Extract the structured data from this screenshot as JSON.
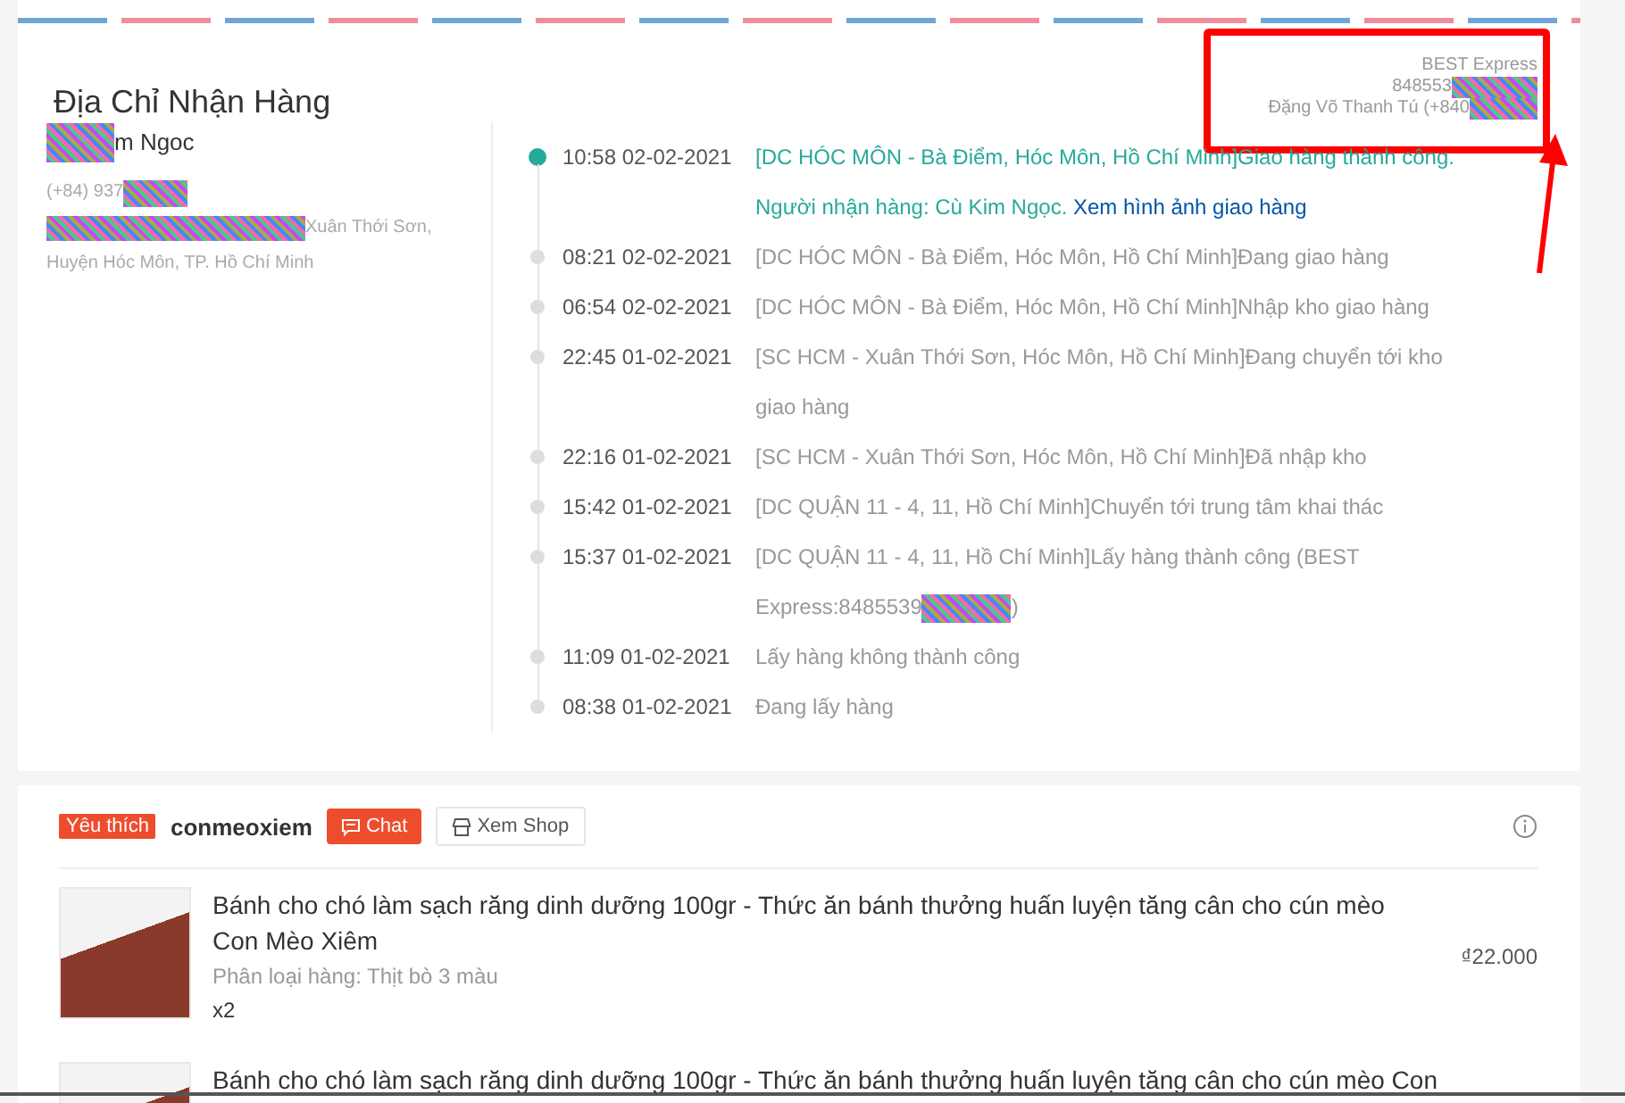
{
  "address": {
    "title": "Địa Chỉ Nhận Hàng",
    "name_tail": "m Ngoc",
    "phone": "(+84) 937",
    "address_line": "Xuân Thới Sơn,",
    "address_line_2": "Huyện Hóc Môn, TP. Hồ Chí Minh"
  },
  "carrier": {
    "name": "BEST Express",
    "tracking": "848553",
    "shipper": "Đặng Võ Thanh Tú (+840"
  },
  "events": [
    {
      "time": "10:58 02-02-2021",
      "active": true,
      "segments": [
        {
          "kind": "text",
          "text": "[DC HÓC MÔN - Bà Điểm, Hóc Môn, Hồ Chí Minh]Giao hàng thành công. Người nhận hàng: Cù Kim Ngọc. "
        },
        {
          "kind": "link",
          "text": "Xem hình ảnh giao hàng"
        }
      ]
    },
    {
      "time": "08:21 02-02-2021",
      "active": false,
      "segments": [
        {
          "kind": "text",
          "text": "[DC HÓC MÔN - Bà Điểm, Hóc Môn, Hồ Chí Minh]Đang giao hàng"
        }
      ]
    },
    {
      "time": "06:54 02-02-2021",
      "active": false,
      "segments": [
        {
          "kind": "text",
          "text": "[DC HÓC MÔN - Bà Điểm, Hóc Môn, Hồ Chí Minh]Nhập kho giao hàng"
        }
      ]
    },
    {
      "time": "22:45 01-02-2021",
      "active": false,
      "segments": [
        {
          "kind": "text",
          "text": "[SC HCM - Xuân Thới Sơn, Hóc Môn, Hồ Chí Minh]Đang chuyển tới kho giao hàng"
        }
      ]
    },
    {
      "time": "22:16 01-02-2021",
      "active": false,
      "segments": [
        {
          "kind": "text",
          "text": "[SC HCM - Xuân Thới Sơn, Hóc Môn, Hồ Chí Minh]Đã nhập kho"
        }
      ]
    },
    {
      "time": "15:42 01-02-2021",
      "active": false,
      "segments": [
        {
          "kind": "text",
          "text": "[DC QUẬN 11 - 4, 11, Hồ Chí Minh]Chuyển tới trung tâm khai thác"
        }
      ]
    },
    {
      "time": "15:37 01-02-2021",
      "active": false,
      "segments": [
        {
          "kind": "text",
          "text": "[DC QUẬN 11 - 4, 11, Hồ Chí Minh]Lấy hàng thành công (BEST Express:8485539"
        },
        {
          "kind": "redacted"
        },
        {
          "kind": "text",
          "text": ")"
        }
      ]
    },
    {
      "time": "11:09 01-02-2021",
      "active": false,
      "segments": [
        {
          "kind": "text",
          "text": "Lấy hàng không thành công"
        }
      ]
    },
    {
      "time": "08:38 01-02-2021",
      "active": false,
      "segments": [
        {
          "kind": "text",
          "text": "Đang lấy hàng"
        }
      ]
    }
  ],
  "shop": {
    "badge": "Yêu thích",
    "name": "conmeoxiem",
    "chat_button": "Chat",
    "view_shop_button": "Xem Shop"
  },
  "products": [
    {
      "title": "Bánh cho chó làm sạch răng dinh dưỡng 100gr - Thức ăn bánh thưởng huấn luyện tăng cân cho cún mèo Con Mèo Xiêm",
      "variation": "Phân loại hàng: Thịt bò 3 màu",
      "quantity": "x2",
      "price": "₫22.000"
    },
    {
      "title": "Bánh cho chó làm sạch răng dinh dưỡng 100gr - Thức ăn bánh thưởng huấn luyện tăng cân cho cún mèo Con"
    }
  ]
}
